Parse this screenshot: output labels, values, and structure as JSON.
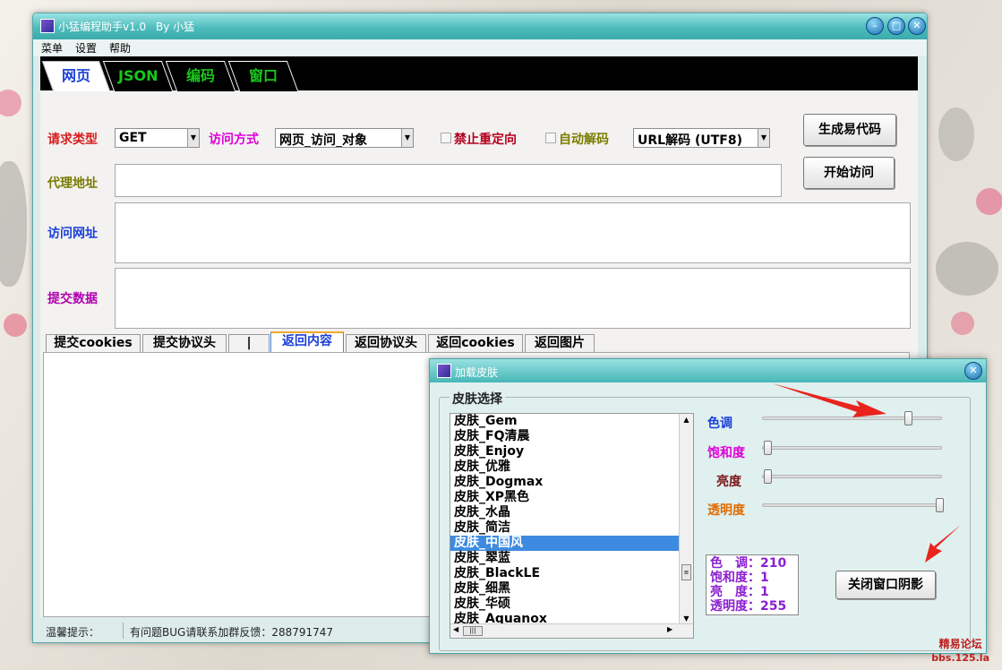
{
  "window": {
    "title": "小猛编程助手v1.0",
    "author": "By 小猛",
    "menu": [
      "菜单",
      "设置",
      "帮助"
    ]
  },
  "main_tabs": [
    {
      "label": "网页",
      "color": "#1b3fd8"
    },
    {
      "label": "JSON",
      "color": "#0c8a00"
    },
    {
      "label": "编码",
      "color": "#0c8a00"
    },
    {
      "label": "窗口",
      "color": "#0c8a00"
    }
  ],
  "form": {
    "request_type_label": "请求类型",
    "request_type_value": "GET",
    "access_method_label": "访问方式",
    "access_method_value": "网页_访问_对象",
    "no_redirect_label": "禁止重定向",
    "auto_decode_label": "自动解码",
    "decode_value": "URL解码 (UTF8)",
    "proxy_label": "代理地址",
    "url_label": "访问网址",
    "post_label": "提交数据",
    "proxy_value": "",
    "url_value": "",
    "post_value": ""
  },
  "buttons": {
    "generate": "生成易代码",
    "start": "开始访问"
  },
  "sub_tabs": [
    "提交cookies",
    "提交协议头",
    "|",
    "返回内容",
    "返回协议头",
    "返回cookies",
    "返回图片"
  ],
  "status": {
    "hint_label": "温馨提示：",
    "hint_text": "有问题BUG请联系加群反馈：288791747"
  },
  "skin_dialog": {
    "title": "加载皮肤",
    "group_label": "皮肤选择",
    "items": [
      "皮肤_Gem",
      "皮肤_FQ清晨",
      "皮肤_Enjoy",
      "皮肤_优雅",
      "皮肤_Dogmax",
      "皮肤_XP黑色",
      "皮肤_水晶",
      "皮肤_简洁",
      "皮肤_中国风",
      "皮肤_翠蓝",
      "皮肤_BlackLE",
      "皮肤_细黑",
      "皮肤_华硕",
      "皮肤_Aquanox"
    ],
    "selected_item": "皮肤_中国风",
    "hue_label": "色调",
    "saturation_label": "饱和度",
    "brightness_label": "亮度",
    "opacity_label": "透明度",
    "hue_level": 0.82,
    "saturation_level": 0.0,
    "brightness_level": 0.0,
    "opacity_level": 1.0,
    "info_lines": [
      "色　调：210",
      "饱和度：1",
      "亮　度：1",
      "透明度：255"
    ],
    "close_shadow_button": "关闭窗口阴影",
    "label_colors": {
      "hue": "#1b3fd8",
      "saturation": "#e000d8",
      "brightness": "#7a1515",
      "opacity": "#e06a00"
    }
  },
  "watermark": {
    "line1": "精易论坛",
    "line2": "bbs.125.la"
  },
  "label_colors": {
    "request_type": "#d81e1e",
    "access_method": "#e000d8",
    "no_redirect": "#b3001e",
    "auto_decode": "#7c7c00",
    "proxy": "#7a7a00",
    "url": "#1b3fd8",
    "post": "#b000b0"
  }
}
